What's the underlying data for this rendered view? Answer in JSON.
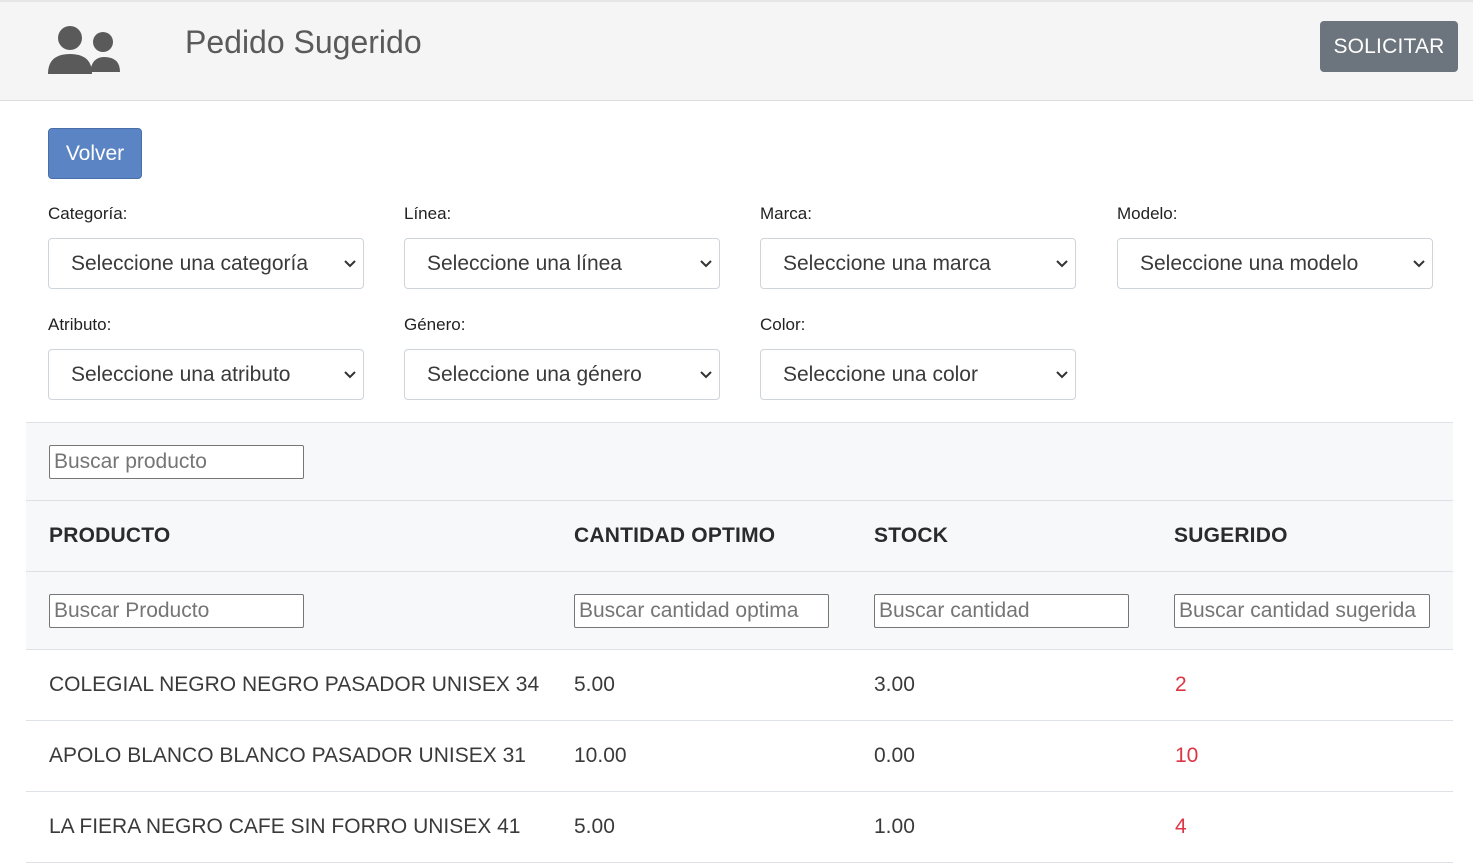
{
  "header": {
    "title": "Pedido Sugerido",
    "icon": "users-icon",
    "solicitar_label": "SOLICITAR"
  },
  "volver_label": "Volver",
  "filters": [
    {
      "label": "Categoría:",
      "value": "Seleccione una categoría"
    },
    {
      "label": "Línea:",
      "value": "Seleccione una línea"
    },
    {
      "label": "Marca:",
      "value": "Seleccione una marca"
    },
    {
      "label": "Modelo:",
      "value": "Seleccione una modelo"
    },
    {
      "label": "Atributo:",
      "value": "Seleccione una atributo"
    },
    {
      "label": "Género:",
      "value": "Seleccione una género"
    },
    {
      "label": "Color:",
      "value": "Seleccione una color"
    }
  ],
  "table": {
    "global_search_placeholder": "Buscar producto",
    "columns": [
      "PRODUCTO",
      "CANTIDAD OPTIMO",
      "STOCK",
      "SUGERIDO"
    ],
    "column_search_placeholders": [
      "Buscar Producto",
      "Buscar cantidad optima",
      "Buscar cantidad",
      "Buscar cantidad sugerida"
    ],
    "rows": [
      {
        "producto": "COLEGIAL NEGRO NEGRO PASADOR UNISEX 34",
        "optimo": "5.00",
        "stock": "3.00",
        "sugerido": "2"
      },
      {
        "producto": "APOLO BLANCO BLANCO PASADOR UNISEX 31",
        "optimo": "10.00",
        "stock": "0.00",
        "sugerido": "10"
      },
      {
        "producto": "LA FIERA NEGRO CAFE SIN FORRO UNISEX 41",
        "optimo": "5.00",
        "stock": "1.00",
        "sugerido": "4"
      }
    ]
  },
  "colors": {
    "header_bg": "#f5f5f5",
    "primary_button": "#5b84c4",
    "secondary_button": "#6c757d",
    "suggested_text": "#dc3545"
  }
}
